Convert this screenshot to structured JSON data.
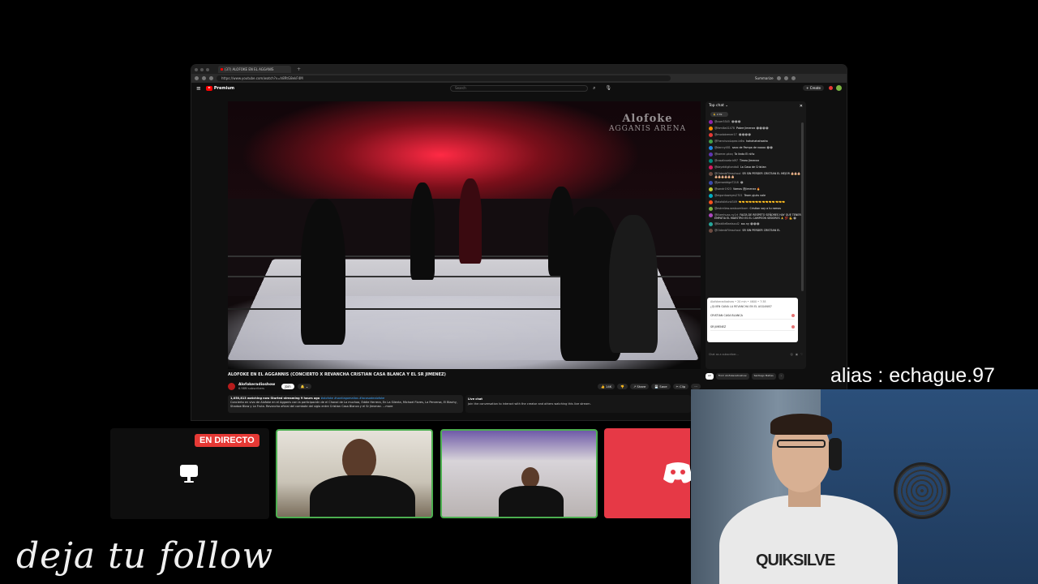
{
  "browser": {
    "tab_title": "(37) ALOFOKE EN EL AGGANIS",
    "url": "https://www.youtube.com/watch?v=h8RtG8ekF4M",
    "summarize_label": "Summarize"
  },
  "youtube": {
    "logo_text": "Premium",
    "search_placeholder": "Search",
    "create_label": "+ Create"
  },
  "video": {
    "watermark_line1": "Alofoke",
    "watermark_line2": "AGGANIS ARENA",
    "title": "ALOFOKE EN EL AGGANNIS (CONCIERTO X REVANCHA CRISTIAN CASA BLANCA Y EL SR JIMENEZ)",
    "channel_name": "Alofokeradioshow",
    "channel_subs": "6.98M subscribers",
    "join_label": "Join",
    "subscribe_label": "🔔 ⌄",
    "actions": [
      "👍 14K",
      "👎",
      "↗ Share",
      "💾 Save",
      "✂ Clip",
      "⋯"
    ],
    "desc_stats": "1,050,813 watching now  Started streaming 9 hours ago",
    "desc_tags": " #alofoke #santiagomatias #lacasadealofoke",
    "desc_text": "Concierto en vivo de Alofoke en el Agganis con la participación de el Chanal de La muchaa, Eddie Herrera, En La Silenta, Michael Flores, La Perversa, El Blachy, Shadow Blow y La Fruta. Revancha oficial del combate del siglo entre Cristian Casa Blanca y el Sr Jimenez. ...more",
    "livechat_title": "Live chat",
    "livechat_prompt": "Join the conversation to interact with the creator and others watching this live stream."
  },
  "chat": {
    "header": "Top chat ⌄",
    "pinned": "🙏 2:39",
    "messages": [
      {
        "user": "@user5545",
        "text": "😂😂😂",
        "color": "#8e24aa"
      },
      {
        "user": "@familia41478",
        "text": "Pobre Jimenez 😂😂😂😂",
        "color": "#fb8c00"
      },
      {
        "user": "@modobrener17",
        "text": "😂😂😂😂",
        "color": "#e53935"
      },
      {
        "user": "@FranciscoLopez-ic6w",
        "text": "hahahahahaaha",
        "color": "#43a047"
      },
      {
        "user": "@danny481",
        "text": "saco de Pampa de noooo 😂😂",
        "color": "#1e88e5"
      },
      {
        "user": "@kamer-pkcq",
        "text": "Ta lindo El niño",
        "color": "#5e35b1"
      },
      {
        "user": "@rosalinoebrid97",
        "text": "Timeo Jimenez",
        "color": "#00897b"
      },
      {
        "user": "@dayeldigitonda0",
        "text": "La Casa de Cristian",
        "color": "#d81b60"
      },
      {
        "user": "@OldenbFilmschool",
        "text": "SR SIN PERDER CRISTIAN EL MEJOR 🎂🎂🎂🎂🎂🎂🎂🎂🎂",
        "color": "#6d4c41"
      },
      {
        "user": "@janweddge7218",
        "text": "😂",
        "color": "#3949ab"
      },
      {
        "user": "@sandr1923",
        "text": "Vamos @jimenez 🔥",
        "color": "#c0ca33"
      },
      {
        "user": "@elgordoweyes2701",
        "text": "Team pjuks vale",
        "color": "#00acc1"
      },
      {
        "user": "@alofolkfunk349",
        "text": "🤜🤜🤜🤜🤜🤜🤜🤜🤜🤜🤜🤜🤜🤜",
        "color": "#f4511e"
      },
      {
        "user": "@estrellaw.seabuzellcom",
        "text": "Cristian voy a tu ramos",
        "color": "#7cb342"
      },
      {
        "user": "@Illamhuaz-ny1rt",
        "text": "FALTA DE RESPETO SEÑORES HAY QUE TENER EMPATIA EL MAESTRO ES EL CAMPEÓN SEÑORES 🙏 💯 💪 😂",
        "color": "#ab47bc"
      },
      {
        "user": "@BakilieBeatsoul2",
        "text": "sss ny 😂😂😂",
        "color": "#26a69a"
      },
      {
        "user": "@OldenbFilmschool",
        "text": "SR SIN PERDER CRISTIAN EL",
        "color": "#6d4c41"
      }
    ],
    "poll": {
      "header": "Alofokeradioshow • 20 min • 4600 • 7:38",
      "question": "¿QUIEN GANA LA REVANCHA EN EL AGGANIS?",
      "options": [
        "CRISTIAN CASA BLANCA",
        "SR JIMENEZ"
      ]
    },
    "input_placeholder": "Chat as a subscriber...",
    "tabs": [
      "All",
      "From Alofokeradioshow",
      "Santiago Matías",
      "›"
    ]
  },
  "overlay": {
    "alias": "alias : echague.97",
    "follow_text": "deja tu follow",
    "live_badge": "EN DIRECTO",
    "webcam_shirt_brand": "QUIKSILVE"
  },
  "colors": {
    "youtube_red": "#ff0000",
    "live_badge_red": "#e53935",
    "discord_panel": "#e63946",
    "thumb_border": "#4caf50"
  }
}
